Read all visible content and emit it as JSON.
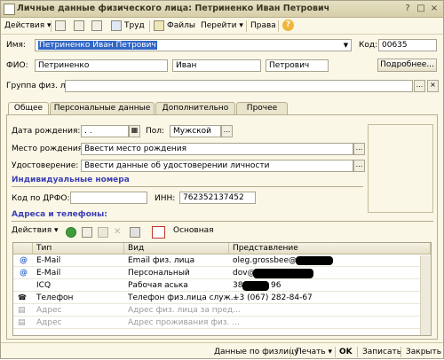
{
  "window": {
    "title": "Личные данные физического лица: Петриненко Иван Петрович"
  },
  "toolbar": {
    "actions": "Действия",
    "trud": "Труд",
    "files": "Файлы",
    "goto": "Перейти",
    "rights": "Права",
    "help": "?"
  },
  "form": {
    "name_label": "Имя:",
    "name_value": "Петриненко Иван Петрович",
    "code_label": "Код:",
    "code_value": "00635",
    "fio_label": "ФИО:",
    "surname": "Петриненко",
    "first_name": "Иван",
    "patronymic": "Петрович",
    "more_button": "Подробнее...",
    "group_label": "Группа физ. лиц:",
    "group_value": ""
  },
  "tabs": [
    {
      "label": "Общее"
    },
    {
      "label": "Персональные данные"
    },
    {
      "label": "Дополнительно"
    },
    {
      "label": "Прочее"
    }
  ],
  "general": {
    "birth_label": "Дата рождения:",
    "birth_value": " .  .",
    "sex_label": "Пол:",
    "sex_value": "Мужской",
    "birthplace_label": "Место рождения:",
    "birthplace_value": "Ввести место рождения",
    "id_label": "Удостоверение:",
    "id_value": "Ввести данные об удостоверении личности",
    "numbers_title": "Индивидуальные номера",
    "drfo_label": "Код по ДРФО:",
    "drfo_value": "",
    "inn_label": "ИНН:",
    "inn_value": "762352137452",
    "contacts_title": "Адреса и телефоны:",
    "contacts_actions": "Действия",
    "contacts_main": "Основная"
  },
  "grid": {
    "headers": [
      "Тип",
      "Вид",
      "Представление"
    ],
    "rows": [
      {
        "type": "E-Mail",
        "kind": "Email физ. лица",
        "repr": "oleg.grossbee@",
        "icon": "at-icon"
      },
      {
        "type": "E-Mail",
        "kind": "Персональный",
        "repr": "dov@",
        "icon": "at-icon"
      },
      {
        "type": "ICQ",
        "kind": "Рабочая аська",
        "repr": "38",
        "repr_tail": "96",
        "icon": ""
      },
      {
        "type": "Телефон",
        "kind": "Телефон физ.лица служ...",
        "repr": "+3 (067) 282-84-67",
        "icon": "phone-icon"
      },
      {
        "type": "Адрес",
        "kind": "Адрес физ. лица за пред...",
        "repr": "",
        "icon": "address-icon"
      },
      {
        "type": "Адрес",
        "kind": "Адрес проживания физ. ...",
        "repr": "",
        "icon": "address-icon"
      }
    ]
  },
  "statusbar": {
    "data_by_person": "Данные по физлицу",
    "print": "Печать",
    "ok": "OK",
    "save": "Записать",
    "close": "Закрыть"
  },
  "colors": {
    "accent": "#3166c5",
    "group_title": "#3b3fb7",
    "background": "#fbf7e6"
  }
}
